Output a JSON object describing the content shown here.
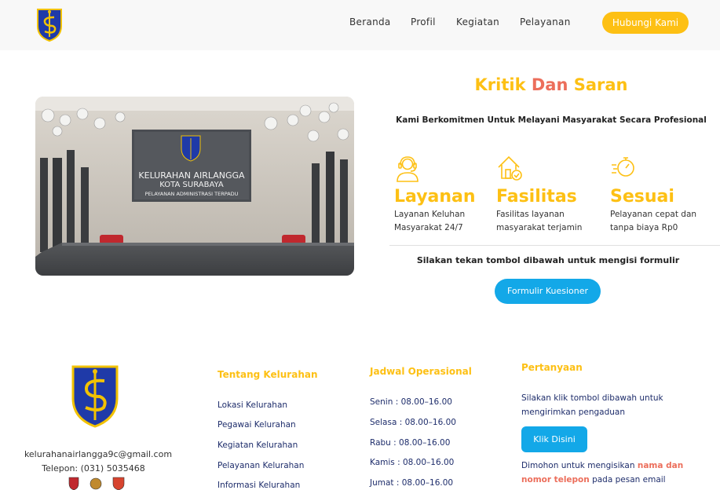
{
  "colors": {
    "accent": "#fdc014",
    "secondary": "#ec6e5b",
    "button_blue": "#13a8e8",
    "link_navy": "#1e2d6b"
  },
  "nav": {
    "logo_icon": "surabaya-crest",
    "links": [
      "Beranda",
      "Profil",
      "Kegiatan",
      "Pelayanan"
    ],
    "cta": "Hubungi Kami"
  },
  "hero": {
    "sign_line1": "KELURAHAN AIRLANGGA",
    "sign_line2": "KOTA SURABAYA",
    "sign_line3": "PELAYANAN ADMINISTRASI TERPADU"
  },
  "section": {
    "title_part1": "Kritik",
    "title_part2": "Dan",
    "title_part3": "Saran",
    "subtitle": "Kami Berkomitmen Untuk Melayani Masyarakat Secara Profesional",
    "features": [
      {
        "icon": "customer-service-icon",
        "name": "Layanan",
        "desc1": "Layanan Keluhan",
        "desc2": "Masyarakat 24/7"
      },
      {
        "icon": "house-check-icon",
        "name": "Fasilitas",
        "desc1": "Fasilitas layanan",
        "desc2": "masyarakat terjamin"
      },
      {
        "icon": "stopwatch-fast-icon",
        "name": "Sesuai",
        "desc1": "Pelayanan cepat dan",
        "desc2": "tanpa biaya Rp0"
      }
    ],
    "cta_text": "Silakan tekan tombol dibawah untuk mengisi formulir",
    "cta_button": "Formulir Kuesioner"
  },
  "footer": {
    "email": "kelurahanairlangga9c@gmail.com",
    "phone": "Telepon: (031) 5035468",
    "about": {
      "heading": "Tentang Kelurahan",
      "links": [
        "Lokasi Kelurahan",
        "Pegawai Kelurahan",
        "Kegiatan Kelurahan",
        "Pelayanan Kelurahan",
        "Informasi Kelurahan"
      ]
    },
    "schedule": {
      "heading": "Jadwal Operasional",
      "items": [
        "Senin : 08.00–16.00",
        "Selasa : 08.00–16.00",
        "Rabu : 08.00–16.00",
        "Kamis : 08.00–16.00",
        "Jumat : 08.00–16.00"
      ]
    },
    "questions": {
      "heading": "Pertanyaan",
      "text1": "Silakan klik tombol dibawah untuk",
      "text2": "mengirimkan pengaduan",
      "button": "Klik Disini",
      "note_a": "Dimohon untuk mengisikan ",
      "note_b": "nama dan",
      "note_c": "nomor telepon",
      "note_d": " pada pesan email"
    }
  }
}
